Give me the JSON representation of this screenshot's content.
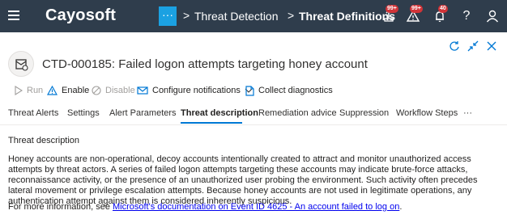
{
  "app": {
    "brand": "Cayosoft"
  },
  "topbar": {
    "more_label": "···",
    "breadcrumb": [
      {
        "label": "Threat Detection"
      },
      {
        "label": "Threat Definitions"
      }
    ],
    "separator": ">",
    "badges": {
      "alerts": "99+",
      "warnings": "99+",
      "notifications": "40"
    },
    "icons": [
      "menu-icon",
      "alert-icon",
      "warning-icon",
      "bell-icon",
      "help-icon",
      "user-icon"
    ]
  },
  "header": {
    "title": "CTD-000185: Failed logon attempts targeting honey account",
    "window_icons": [
      "refresh-icon",
      "collapse-icon",
      "close-icon"
    ]
  },
  "toolbar": {
    "run": "Run",
    "enable": "Enable",
    "disable": "Disable",
    "configure_notifications": "Configure notifications",
    "collect_diagnostics": "Collect diagnostics"
  },
  "tabs": [
    {
      "label": "Threat Alerts"
    },
    {
      "label": "Settings"
    },
    {
      "label": "Alert Parameters"
    },
    {
      "label": "Threat description",
      "active": true
    },
    {
      "label": "Remediation advice"
    },
    {
      "label": "Suppression"
    },
    {
      "label": "Workflow Steps"
    },
    {
      "label": "···"
    }
  ],
  "content": {
    "section_title": "Threat description",
    "description": "Honey accounts are non-operational, decoy accounts intentionally created to attract and monitor unauthorized access attempts by threat actors. A series of failed logon attempts targeting these accounts may indicate brute-force attacks, reconnaissance activity, or the presence of an unauthorized user probing the environment. Such activity often precedes lateral movement or privilege escalation attempts. Because honey accounts are not used in legitimate operations, any authentication attempt against them is considered inherently suspicious.",
    "more_info_prefix": "For more information, see ",
    "more_info_link": "Microsoft's documentation on Event ID 4625 - An account failed to log on",
    "more_info_suffix": "."
  },
  "colors": {
    "topbar": "#2f3d4c",
    "accent": "#0078d4",
    "dots_button": "#1ba1e2",
    "badge": "#d13438",
    "link": "#0000ee"
  }
}
